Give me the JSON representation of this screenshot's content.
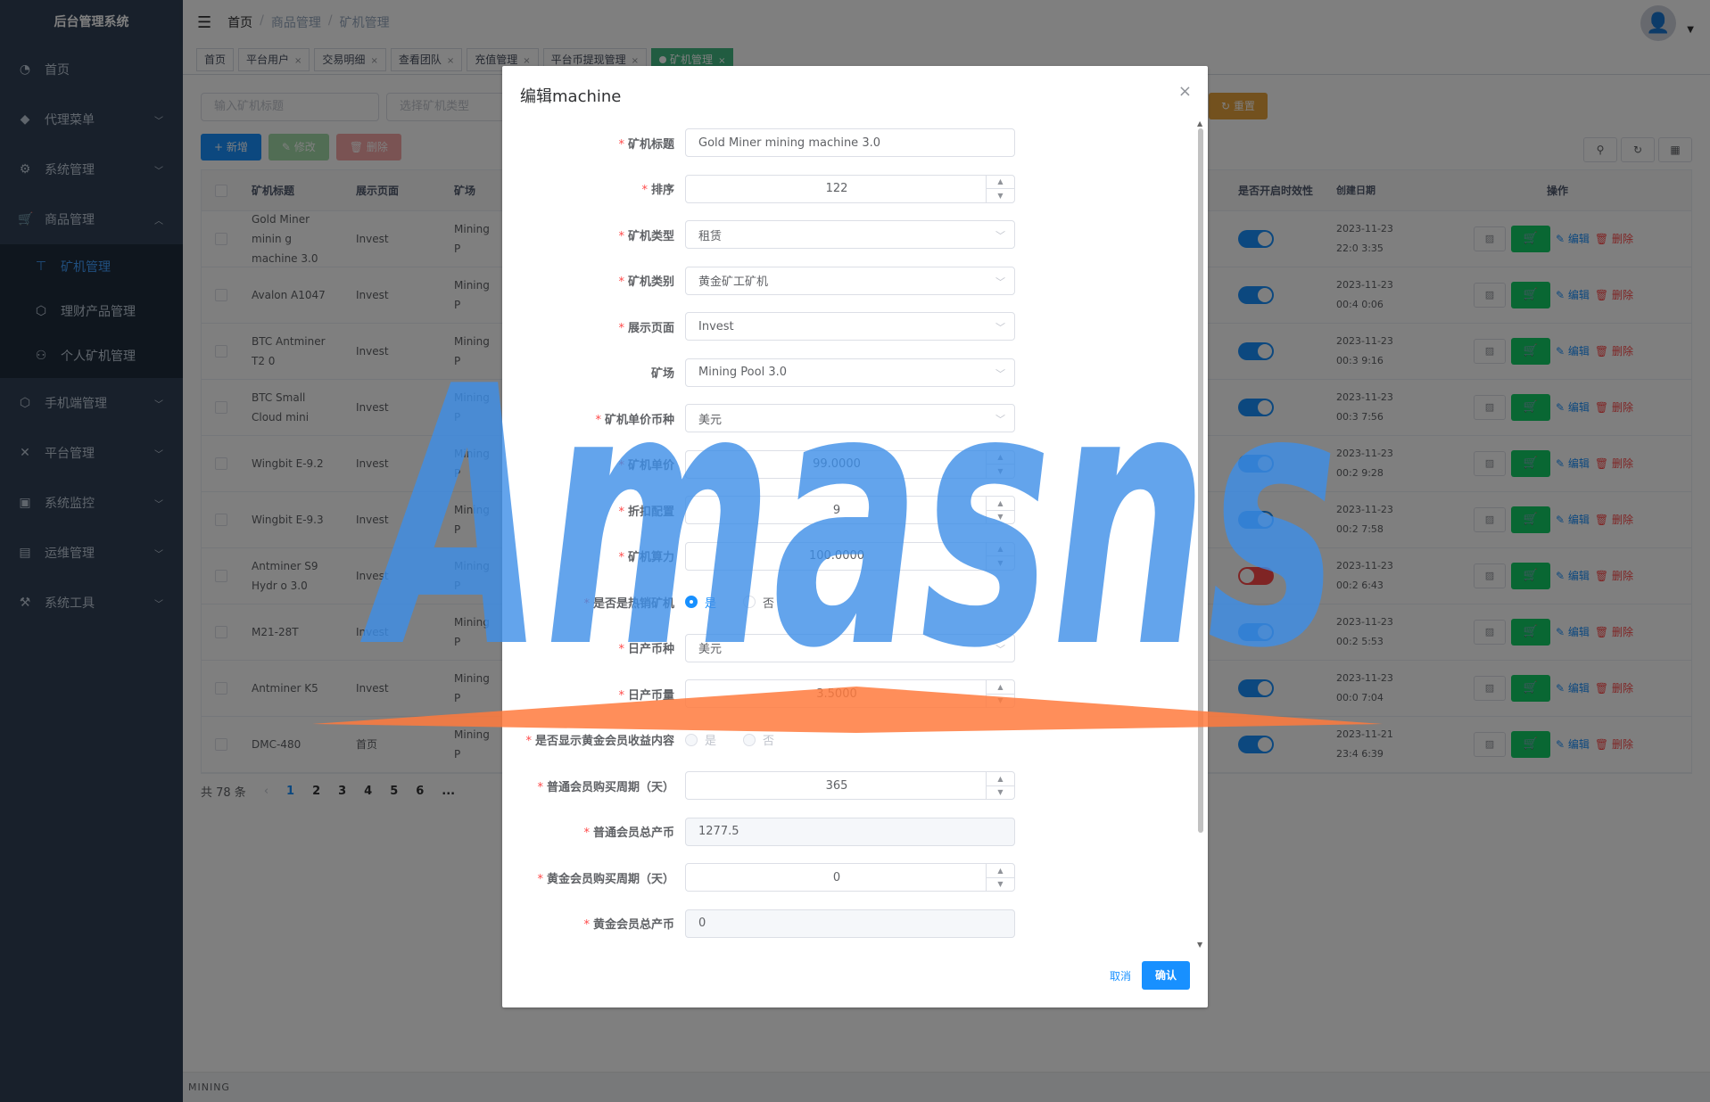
{
  "app": {
    "logo": "后台管理系统"
  },
  "sidebar": {
    "items": [
      {
        "label": "首页",
        "icon": "◔"
      },
      {
        "label": "代理菜单",
        "icon": "◆"
      },
      {
        "label": "系统管理",
        "icon": "⚙"
      },
      {
        "label": "商品管理",
        "icon": "🛒"
      },
      {
        "label": "手机端管理",
        "icon": "⬡"
      },
      {
        "label": "平台管理",
        "icon": "✕"
      },
      {
        "label": "系统监控",
        "icon": "▣"
      },
      {
        "label": "运维管理",
        "icon": "▤"
      },
      {
        "label": "系统工具",
        "icon": "⚒"
      }
    ],
    "submenu": [
      {
        "label": "矿机管理",
        "icon": "⊤"
      },
      {
        "label": "理财产品管理",
        "icon": "⬡"
      },
      {
        "label": "个人矿机管理",
        "icon": "⚇"
      }
    ]
  },
  "navbar": {
    "breadcrumb": [
      "首页",
      "商品管理",
      "矿机管理"
    ]
  },
  "tags": [
    {
      "label": "首页",
      "active": false
    },
    {
      "label": "平台用户",
      "active": false
    },
    {
      "label": "交易明细",
      "active": false
    },
    {
      "label": "查看团队",
      "active": false
    },
    {
      "label": "充值管理",
      "active": false
    },
    {
      "label": "平台币提现管理",
      "active": false
    },
    {
      "label": "矿机管理",
      "active": true
    }
  ],
  "search": {
    "title_placeholder": "输入矿机标题",
    "type_placeholder": "选择矿机类型",
    "reset_label": "重置"
  },
  "toolbar": {
    "add_label": "新增",
    "edit_label": "修改",
    "delete_label": "删除"
  },
  "table": {
    "headers": {
      "title": "矿机标题",
      "page": "展示页面",
      "field": "矿场",
      "switch": "是否开启时效性",
      "date": "创建日期",
      "ops": "操作"
    },
    "rows": [
      {
        "title": "Gold Miner minin g machine 3.0",
        "page": "Invest",
        "field": "Mining P",
        "switch_on": true,
        "date": "2023-11-23 22:0 3:35"
      },
      {
        "title": "Avalon A1047",
        "page": "Invest",
        "field": "Mining P",
        "switch_on": true,
        "date": "2023-11-23 00:4 0:06"
      },
      {
        "title": "BTC Antminer T2 0",
        "page": "Invest",
        "field": "Mining P",
        "switch_on": true,
        "date": "2023-11-23 00:3 9:16"
      },
      {
        "title": "BTC Small Cloud mini",
        "page": "Invest",
        "field": "Mining P",
        "switch_on": true,
        "date": "2023-11-23 00:3 7:56"
      },
      {
        "title": "Wingbit E-9.2",
        "page": "Invest",
        "field": "Mining P",
        "switch_on": true,
        "date": "2023-11-23 00:2 9:28"
      },
      {
        "title": "Wingbit E-9.3",
        "page": "Invest",
        "field": "Mining P",
        "switch_on": true,
        "date": "2023-11-23 00:2 7:58"
      },
      {
        "title": "Antminer S9 Hydr o 3.0",
        "page": "Invest",
        "field": "Mining P",
        "switch_on": false,
        "date": "2023-11-23 00:2 6:43"
      },
      {
        "title": "M21-28T",
        "page": "Invest",
        "field": "Mining P",
        "switch_on": true,
        "date": "2023-11-23 00:2 5:53"
      },
      {
        "title": "Antminer K5",
        "page": "Invest",
        "field": "Mining P",
        "switch_on": true,
        "date": "2023-11-23 00:0 7:04"
      },
      {
        "title": "DMC-480",
        "page": "首页",
        "field": "Mining P",
        "switch_on": true,
        "date": "2023-11-21 23:4 6:39"
      }
    ],
    "op_edit": "编辑",
    "op_delete": "删除"
  },
  "pagination": {
    "total": "共 78 条",
    "pages": [
      "1",
      "2",
      "3",
      "4",
      "5",
      "6",
      "..."
    ],
    "current": "1"
  },
  "footer": {
    "text": "MINING"
  },
  "dialog": {
    "title": "编辑machine",
    "fields": [
      {
        "label": "矿机标题",
        "required": true,
        "kind": "input",
        "value": "Gold Miner mining machine 3.0"
      },
      {
        "label": "排序",
        "required": true,
        "kind": "number",
        "value": "122"
      },
      {
        "label": "矿机类型",
        "required": true,
        "kind": "select",
        "value": "租赁"
      },
      {
        "label": "矿机类别",
        "required": true,
        "kind": "select",
        "value": "黄金矿工矿机"
      },
      {
        "label": "展示页面",
        "required": true,
        "kind": "select",
        "value": "Invest"
      },
      {
        "label": "矿场",
        "required": false,
        "kind": "select",
        "value": "Mining Pool 3.0"
      },
      {
        "label": "矿机单价币种",
        "required": true,
        "kind": "select",
        "value": "美元"
      },
      {
        "label": "矿机单价",
        "required": true,
        "kind": "number",
        "value": "99.0000"
      },
      {
        "label": "折扣配置",
        "required": true,
        "kind": "number",
        "value": "9"
      },
      {
        "label": "矿机算力",
        "required": true,
        "kind": "number",
        "value": "100.0000"
      },
      {
        "label": "是否是热销矿机",
        "required": true,
        "kind": "radio",
        "options": [
          "是",
          "否"
        ],
        "selected": "是",
        "disabled": false
      },
      {
        "label": "日产币种",
        "required": true,
        "kind": "select",
        "value": "美元"
      },
      {
        "label": "日产币量",
        "required": true,
        "kind": "number",
        "value": "3.5000"
      },
      {
        "label": "是否显示黄金会员收益内容",
        "required": true,
        "kind": "radio",
        "options": [
          "是",
          "否"
        ],
        "selected": "是",
        "disabled": true
      },
      {
        "label": "普通会员购买周期（天）",
        "required": true,
        "kind": "number",
        "value": "365"
      },
      {
        "label": "普通会员总产币",
        "required": true,
        "kind": "input-disabled",
        "value": "1277.5"
      },
      {
        "label": "黄金会员购买周期（天）",
        "required": true,
        "kind": "number",
        "value": "0"
      },
      {
        "label": "黄金会员总产币",
        "required": true,
        "kind": "input-disabled",
        "value": "0"
      }
    ],
    "cancel_label": "取消",
    "confirm_label": "确认"
  },
  "watermark": {
    "text": "Amasns"
  },
  "colors": {
    "sidebar_bg": "#304156",
    "primary": "#1890ff",
    "success": "#13ce66",
    "danger": "#ff4949",
    "warning": "#e6a23c",
    "tag_active": "#42b983",
    "watermark_blue": "#3d8ee8",
    "watermark_orange": "#ff7a3d"
  }
}
